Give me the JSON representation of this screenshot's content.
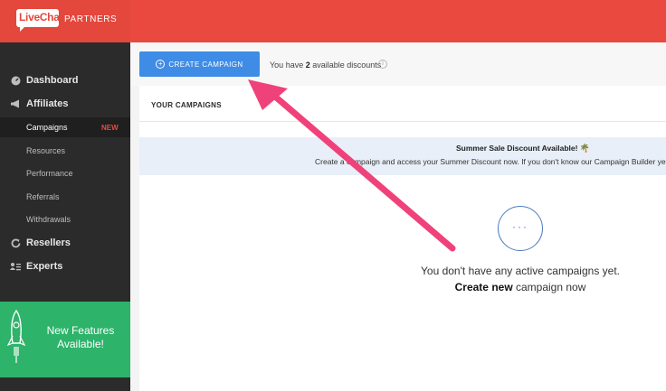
{
  "app": {
    "logo_text": "LiveChat",
    "logo_suffix": "PARTNERS"
  },
  "sidebar": {
    "items": [
      {
        "label": "Dashboard",
        "icon": "dashboard-icon"
      },
      {
        "label": "Affiliates",
        "icon": "megaphone-icon"
      },
      {
        "label": "Resellers",
        "icon": "refresh-icon"
      },
      {
        "label": "Experts",
        "icon": "experts-icon"
      }
    ],
    "sub_items": [
      {
        "label": "Campaigns",
        "badge": "NEW",
        "active": true
      },
      {
        "label": "Resources"
      },
      {
        "label": "Performance"
      },
      {
        "label": "Referrals"
      },
      {
        "label": "Withdrawals"
      }
    ],
    "features": {
      "line1": "New Features",
      "line2": "Available!",
      "icon": "rocket-icon"
    }
  },
  "toolbar": {
    "create_label": "CREATE CAMPAIGN",
    "discount_prefix": "You have ",
    "discount_count": "2",
    "discount_suffix": " available discounts",
    "info": "i"
  },
  "campaigns": {
    "title": "YOUR CAMPAIGNS",
    "banner_title": "Summer Sale Discount Available!",
    "banner_emoji": "🌴",
    "banner_text": "Create a campaign and access your Summer Discount now. If you don't know our Campaign Builder yet,",
    "empty_dots": "···",
    "empty_line1": "You don't have any active campaigns yet.",
    "empty_bold": "Create new",
    "empty_rest": " campaign now"
  },
  "colors": {
    "brand_red": "#e9493e",
    "sidebar_dark": "#2b2b2b",
    "features_green": "#2db36a",
    "button_blue": "#3f8ce6",
    "annotation_arrow": "#f0427a"
  }
}
